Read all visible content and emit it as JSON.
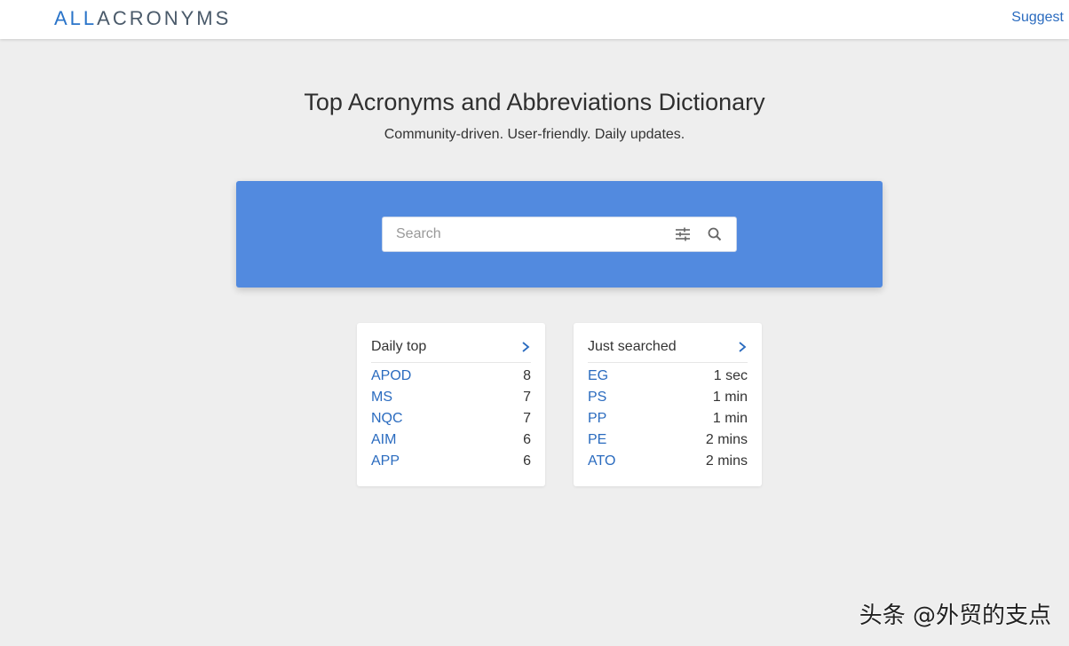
{
  "header": {
    "logo_prefix": "ALL",
    "logo_main": "ACRONYMS",
    "suggest_label": "Suggest"
  },
  "hero": {
    "title": "Top Acronyms and Abbreviations Dictionary",
    "subtitle": "Community-driven. User-friendly. Daily updates."
  },
  "search": {
    "placeholder": "Search",
    "value": "",
    "filter_icon": "sliders-icon",
    "search_icon": "magnifier-icon"
  },
  "daily_top": {
    "title": "Daily top",
    "items": [
      {
        "acronym": "APOD",
        "count": "8"
      },
      {
        "acronym": "MS",
        "count": "7"
      },
      {
        "acronym": "NQC",
        "count": "7"
      },
      {
        "acronym": "AIM",
        "count": "6"
      },
      {
        "acronym": "APP",
        "count": "6"
      }
    ]
  },
  "just_searched": {
    "title": "Just searched",
    "items": [
      {
        "acronym": "EG",
        "time": "1 sec"
      },
      {
        "acronym": "PS",
        "time": "1 min"
      },
      {
        "acronym": "PP",
        "time": "1 min"
      },
      {
        "acronym": "PE",
        "time": "2 mins"
      },
      {
        "acronym": "ATO",
        "time": "2 mins"
      }
    ]
  },
  "watermark": "头条 @外贸的支点",
  "colors": {
    "accent": "#528adf",
    "link": "#2a6bbf",
    "background": "#eeeeee"
  }
}
